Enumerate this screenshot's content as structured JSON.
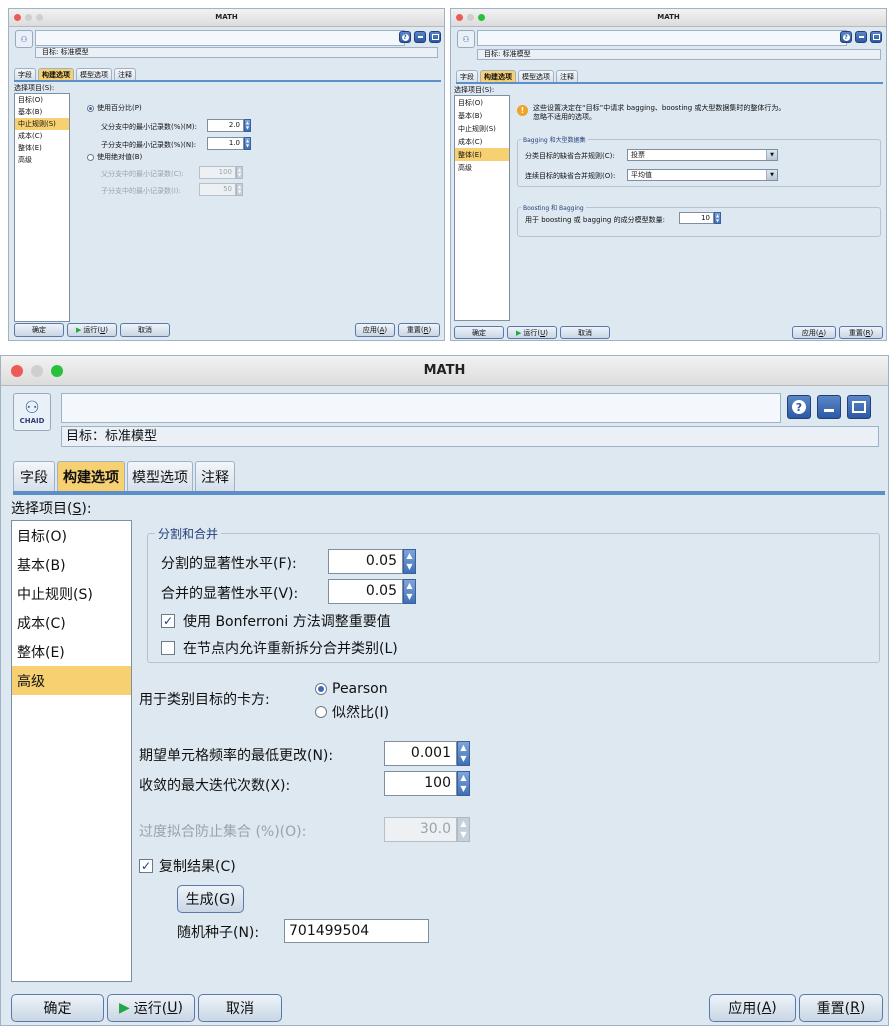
{
  "app": {
    "title": "MATH",
    "logo_caption": "CHAID"
  },
  "objective_label": "目标: 标准模型",
  "objective_label_large": "目标：标准模型",
  "tabs": [
    "字段",
    "构建选项",
    "模型选项",
    "注释"
  ],
  "select_label": "选择项目(S):",
  "select_underline_char": "S",
  "nav": [
    "目标(O)",
    "基本(B)",
    "中止规则(S)",
    "成本(C)",
    "整体(E)",
    "高级"
  ],
  "footer": {
    "ok": "确定",
    "run_prefix": "运行(",
    "run_key": "U",
    "cancel": "取消",
    "apply_prefix": "应用(",
    "apply_key": "A",
    "reset_prefix": "重置(",
    "reset_key": "R",
    "close_paren": ")"
  },
  "panel_basic": {
    "use_percent": "使用百分比(P)",
    "parent_min_pct_label": "父分支中的最小记录数(%)(M):",
    "parent_min_pct": "2.0",
    "child_min_pct_label": "子分支中的最小记录数(%)(N):",
    "child_min_pct": "1.0",
    "use_absolute": "使用绝对值(B)",
    "parent_min_abs_label": "父分支中的最小记录数(C):",
    "parent_min_abs": "100",
    "child_min_abs_label": "子分支中的最小记录数(I):",
    "child_min_abs": "50"
  },
  "panel_ensemble": {
    "info": "这些设置决定在“目标”中请求 bagging、boosting 或大型数据集时的整体行为。忽略不适用的选项。",
    "info_line1": "这些设置决定在“目标”中请求 bagging、boosting 或大型数据集时的整体行为。",
    "info_line2": "忽略不适用的选项。",
    "group1_title": "Bagging 和大型数据集",
    "categorical_rule_label": "分类目标的缺省合并规则(C):",
    "categorical_rule": "投票",
    "continuous_rule_label": "连续目标的缺省合并规则(O):",
    "continuous_rule": "平均值",
    "group2_title": "Boosting 和 Bagging",
    "num_models_label": "用于 boosting 或 bagging 的成分模型数量:",
    "num_models": "10"
  },
  "panel_advanced": {
    "group_title": "分割和合并",
    "split_sig_label": "分割的显著性水平(F):",
    "split_sig": "0.05",
    "merge_sig_label": "合并的显著性水平(V):",
    "merge_sig": "0.05",
    "bonferroni": "使用 Bonferroni 方法调整重要值",
    "bonferroni_checked": true,
    "resplit": "在节点内允许重新拆分合并类别(L)",
    "resplit_checked": false,
    "chi_label": "用于类别目标的卡方:",
    "chi_pearson": "Pearson",
    "chi_likelihood": "似然比(I)",
    "chi_selected": "Pearson",
    "min_change_label": "期望单元格频率的最低更改(N):",
    "min_change": "0.001",
    "max_iter_label": "收敛的最大迭代次数(X):",
    "max_iter": "100",
    "overfit_label": "过度拟合防止集合 (%)(O):",
    "overfit": "30.0",
    "replicate": "复制结果(C)",
    "replicate_checked": true,
    "generate": "生成(G)",
    "seed_label": "随机种子(N):",
    "seed": "701499504"
  }
}
